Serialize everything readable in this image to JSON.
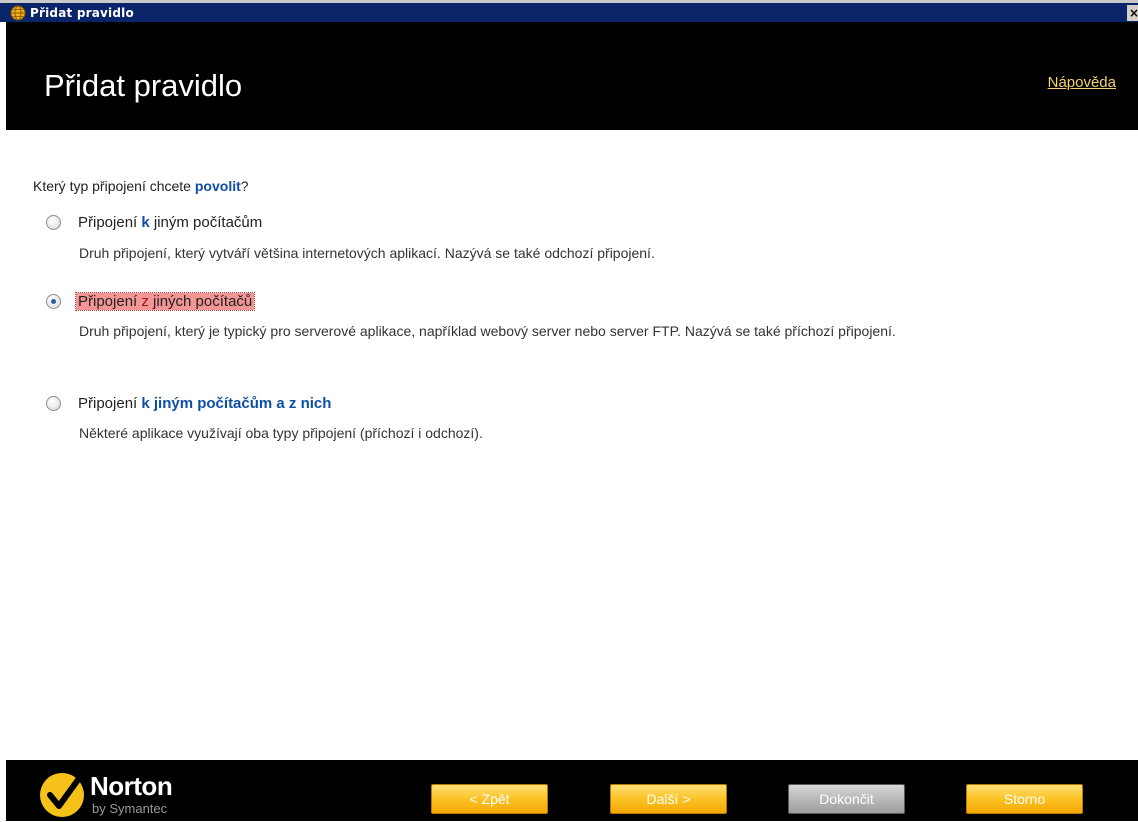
{
  "window": {
    "title": "Přidat pravidlo",
    "icon": "globe-icon",
    "close_glyph": "×"
  },
  "header": {
    "title": "Přidat pravidlo",
    "help_link": "Nápověda"
  },
  "question": {
    "prefix": "Který typ připojení chcete ",
    "keyword": "povolit",
    "suffix": "?"
  },
  "options": [
    {
      "label_prefix": "Připojení ",
      "label_keyword": "k",
      "label_suffix": " jiným počítačům",
      "description": "Druh připojení, který vytváří většina internetových aplikací. Nazývá se také odchozí připojení.",
      "selected": false
    },
    {
      "label_prefix": "Připojení ",
      "label_keyword": "z",
      "label_suffix": " jiných počítačů",
      "description": "Druh připojení, který je typický pro serverové aplikace, například webový server nebo server FTP. Nazývá se také příchozí připojení.",
      "selected": true
    },
    {
      "label_prefix": "Připojení ",
      "label_keyword": "k jiným počítačům a z nich",
      "label_suffix": "",
      "description": "Některé aplikace využívají oba typy připojení (příchozí i odchozí).",
      "selected": false
    }
  ],
  "footer": {
    "logo_brand": "Norton",
    "logo_sub": "by Symantec",
    "buttons": {
      "back": "< Zpět",
      "next": "Další >",
      "finish": "Dokončit",
      "cancel": "Storno"
    }
  },
  "colors": {
    "accent_blue": "#0f4ea6",
    "button_yellow": "#fbc52a",
    "selection_red": "#f49595",
    "header_bg": "#000000"
  }
}
